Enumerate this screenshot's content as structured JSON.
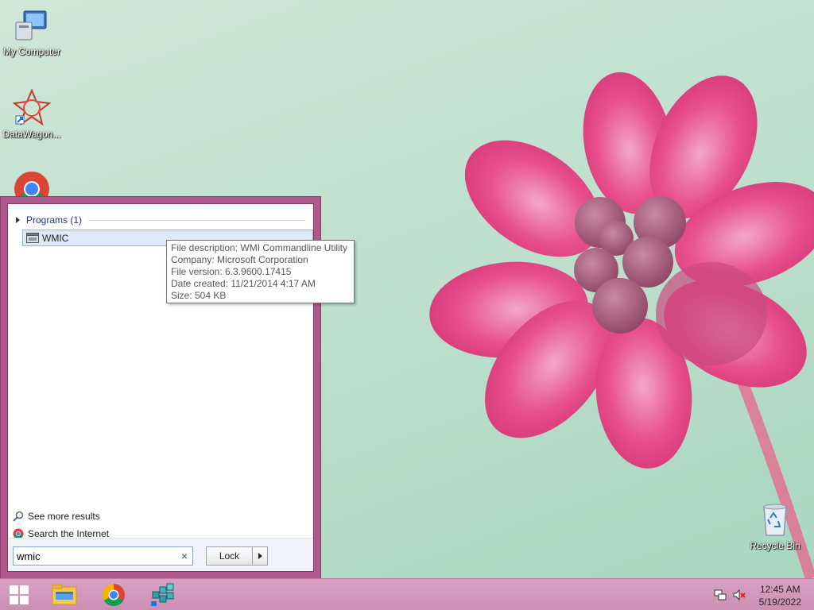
{
  "desktop": {
    "icons": [
      {
        "label": "My Computer",
        "icon": "my-computer-icon"
      },
      {
        "label": "DataWagon...",
        "icon": "datawagon-icon"
      },
      {
        "label": "",
        "icon": "chrome-icon"
      },
      {
        "label": "Recycle Bin",
        "icon": "recycle-bin-icon"
      }
    ]
  },
  "start_menu": {
    "group_header": "Programs (1)",
    "results": [
      {
        "label": "WMIC",
        "icon": "wmic-icon"
      }
    ],
    "see_more": "See more results",
    "search_internet": "Search the Internet",
    "search": {
      "value": "wmic",
      "clear_glyph": "×"
    },
    "lock_label": "Lock"
  },
  "tooltip": {
    "lines": [
      "File description: WMI Commandline Utility",
      "Company: Microsoft Corporation",
      "File version: 6.3.9600.17415",
      "Date created: 11/21/2014 4:17 AM",
      "Size: 504 KB"
    ]
  },
  "taskbar": {
    "pinned": [
      "start-windows-icon",
      "file-explorer-icon",
      "chrome-icon",
      "network-cubes-icon"
    ],
    "clock": {
      "time": "12:45 AM",
      "date": "5/19/2022"
    },
    "tray": [
      "network-icon",
      "volume-muted-icon"
    ]
  },
  "colors": {
    "accent": "#b0578b",
    "taskbar": "#cc8fb5",
    "wallpaper": "#bfe0cf",
    "flower": "#e84d8a"
  }
}
